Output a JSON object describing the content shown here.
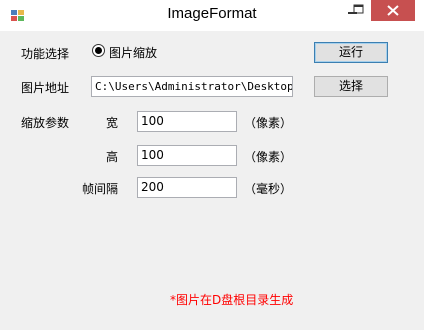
{
  "window": {
    "title": "ImageFormat"
  },
  "form": {
    "function_label": "功能选择",
    "radio_option_label": "图片缩放",
    "radio_selected": true,
    "run_button": "运行",
    "path_label": "图片地址",
    "path_value": "C:\\Users\\Administrator\\Desktop\\fo",
    "select_button": "选择",
    "scale_label": "缩放参数",
    "width_label": "宽",
    "width_value": "100",
    "width_unit": "（像素）",
    "height_label": "高",
    "height_value": "100",
    "height_unit": "（像素）",
    "interval_label": "帧间隔",
    "interval_value": "200",
    "interval_unit": "（毫秒）",
    "note": "*图片在D盘根目录生成"
  },
  "colors": {
    "note_color": "#ff0000",
    "close_button_bg": "#c75050"
  },
  "icons": {
    "app": "app-icon",
    "minimize": "minimize-icon",
    "maximize": "maximize-icon",
    "close": "close-icon"
  }
}
